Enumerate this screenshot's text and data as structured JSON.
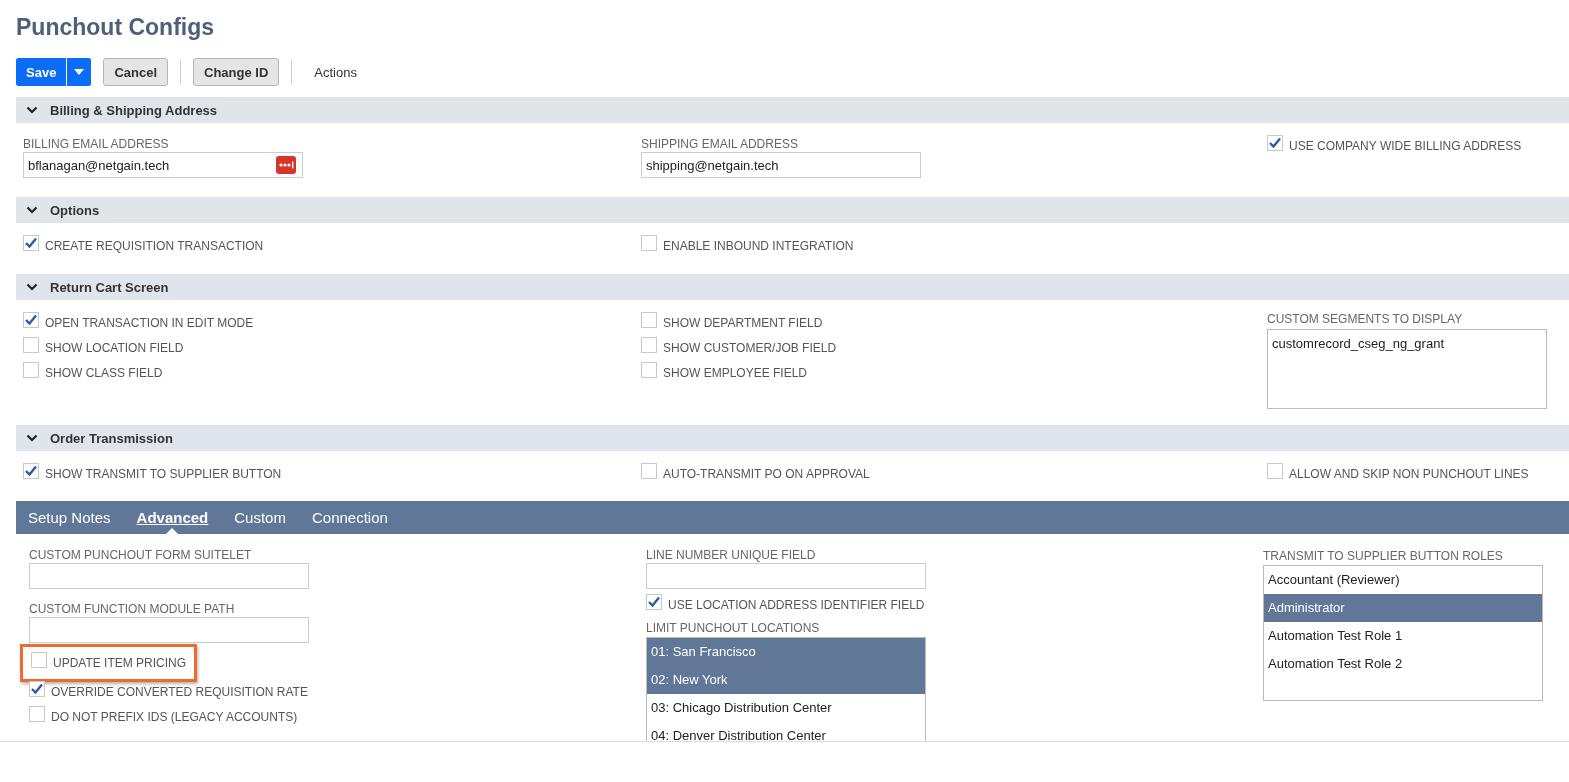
{
  "page": {
    "title": "Punchout Configs"
  },
  "toolbar": {
    "buttons": [
      {
        "label": "Save",
        "kind": "primary"
      },
      {
        "label": "Cancel",
        "kind": "secondary"
      },
      {
        "label": "Change ID",
        "kind": "secondary",
        "divider_before": true
      },
      {
        "label": "Actions",
        "kind": "plain",
        "divider_before": true
      }
    ]
  },
  "sections": [
    {
      "title": "Billing & Shipping Address",
      "expanded": true,
      "columns": [
        [
          {
            "kind": "field",
            "label": "BILLING EMAIL ADDRESS",
            "value": "bflanagan@netgain.tech",
            "autofill_icon": true
          }
        ],
        [
          {
            "kind": "field",
            "label": "SHIPPING EMAIL ADDRESS",
            "value": "shipping@netgain.tech"
          }
        ],
        [
          {
            "kind": "checkbox",
            "label": "USE COMPANY WIDE BILLING ADDRESS",
            "checked": true,
            "highlighted": false
          }
        ]
      ]
    },
    {
      "title": "Options",
      "expanded": true,
      "columns": [
        [
          {
            "kind": "checkbox",
            "label": "CREATE REQUISITION TRANSACTION",
            "checked": true,
            "highlighted": false
          }
        ],
        [
          {
            "kind": "checkbox",
            "label": "ENABLE INBOUND INTEGRATION",
            "checked": false,
            "highlighted": false
          }
        ],
        []
      ]
    },
    {
      "title": "Return Cart Screen",
      "expanded": true,
      "columns": [
        [
          {
            "kind": "checkbox",
            "label": "OPEN TRANSACTION IN EDIT MODE",
            "checked": true,
            "highlighted": false
          },
          {
            "kind": "checkbox",
            "label": "SHOW LOCATION FIELD",
            "checked": false,
            "highlighted": false
          },
          {
            "kind": "checkbox",
            "label": "SHOW CLASS FIELD",
            "checked": false,
            "highlighted": false
          }
        ],
        [
          {
            "kind": "checkbox",
            "label": "SHOW DEPARTMENT FIELD",
            "checked": false,
            "highlighted": false
          },
          {
            "kind": "checkbox",
            "label": "SHOW CUSTOMER/JOB FIELD",
            "checked": false,
            "highlighted": false
          },
          {
            "kind": "checkbox",
            "label": "SHOW EMPLOYEE FIELD",
            "checked": false,
            "highlighted": false
          }
        ],
        [
          {
            "kind": "textarea",
            "label": "CUSTOM SEGMENTS TO DISPLAY",
            "value": "customrecord_cseg_ng_grant"
          }
        ]
      ]
    },
    {
      "title": "Order Transmission",
      "expanded": true,
      "columns": [
        [
          {
            "kind": "checkbox",
            "label": "SHOW TRANSMIT TO SUPPLIER BUTTON",
            "checked": true,
            "highlighted": false
          }
        ],
        [
          {
            "kind": "checkbox",
            "label": "AUTO-TRANSMIT PO ON APPROVAL",
            "checked": false,
            "highlighted": false
          }
        ],
        [
          {
            "kind": "checkbox",
            "label": "ALLOW AND SKIP NON PUNCHOUT LINES",
            "checked": false,
            "highlighted": false
          }
        ]
      ]
    }
  ],
  "subtabs": {
    "tabs": [
      {
        "label": "Setup Notes",
        "selected": false
      },
      {
        "label": "Advanced",
        "selected": true
      },
      {
        "label": "Custom",
        "selected": false
      },
      {
        "label": "Connection",
        "selected": false
      }
    ],
    "columns": [
      [
        {
          "kind": "field",
          "label": "CUSTOM PUNCHOUT FORM SUITELET"
        },
        {
          "kind": "field",
          "label": "CUSTOM FUNCTION MODULE PATH"
        },
        {
          "kind": "checkbox",
          "label": "UPDATE ITEM PRICING",
          "checked": false,
          "highlighted": true
        },
        {
          "kind": "checkbox",
          "label": "OVERRIDE CONVERTED REQUISITION RATE",
          "checked": true,
          "highlighted": false
        },
        {
          "kind": "checkbox",
          "label": "DO NOT PREFIX IDS (LEGACY ACCOUNTS)",
          "checked": false,
          "highlighted": false
        }
      ],
      [
        {
          "kind": "field",
          "label": "LINE NUMBER UNIQUE FIELD"
        },
        {
          "kind": "checkbox",
          "label": "USE LOCATION ADDRESS IDENTIFIER FIELD",
          "checked": true,
          "highlighted": false
        },
        {
          "kind": "listbox",
          "label": "LIMIT PUNCHOUT LOCATIONS",
          "options": [
            {
              "label": "01: San Francisco",
              "selected": true
            },
            {
              "label": "02: New York",
              "selected": true
            },
            {
              "label": "03: Chicago Distribution Center",
              "selected": false
            },
            {
              "label": "04: Denver Distribution Center",
              "selected": false
            }
          ]
        }
      ],
      [
        {
          "kind": "listbox",
          "label": "TRANSMIT TO SUPPLIER BUTTON ROLES",
          "options": [
            {
              "label": "Accountant (Reviewer)",
              "selected": false
            },
            {
              "label": "Administrator",
              "selected": true
            },
            {
              "label": "Automation Test Role 1",
              "selected": false
            },
            {
              "label": "Automation Test Role 2",
              "selected": false
            }
          ]
        }
      ]
    ]
  }
}
